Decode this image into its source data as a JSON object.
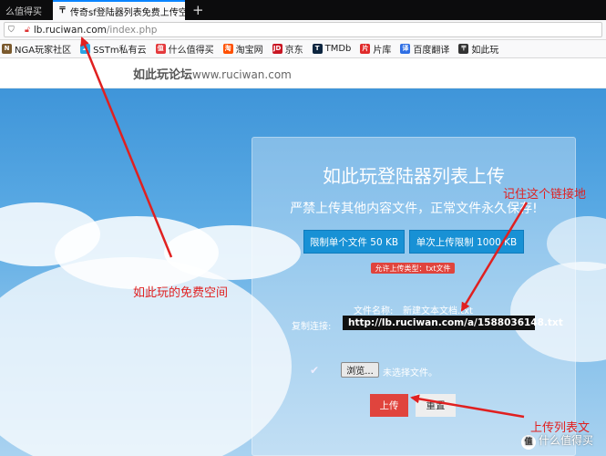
{
  "browser": {
    "tabs": [
      {
        "label": "么值得买",
        "active": false
      },
      {
        "label": "传奇sf登陆器列表免费上传空间",
        "active": true
      }
    ],
    "new_tab_symbol": "+",
    "close_symbol": "✕",
    "url_domain": "lb.ruciwan.com",
    "url_path": "/index.php"
  },
  "bookmarks": [
    {
      "label": "NGA玩家社区",
      "icon": "nga-icon",
      "color": "#7b5a2e"
    },
    {
      "label": "SSTm私有云",
      "icon": "cloud-icon",
      "color": "#2aa4e4"
    },
    {
      "label": "什么值得买",
      "icon": "smzdm-icon",
      "color": "#e4393c"
    },
    {
      "label": "淘宝网",
      "icon": "taobao-icon",
      "color": "#ff5000"
    },
    {
      "label": "京东",
      "icon": "jd-icon",
      "color": "#c91623"
    },
    {
      "label": "TMDb",
      "icon": "tmdb-icon",
      "color": "#0d253f"
    },
    {
      "label": "片库",
      "icon": "pianku-icon",
      "color": "#e02b2b"
    },
    {
      "label": "百度翻译",
      "icon": "baidu-translate-icon",
      "color": "#2f6fe4"
    },
    {
      "label": "如此玩",
      "icon": "ruciwan-icon",
      "color": "#333333"
    }
  ],
  "site": {
    "logo_cn": "如此玩论坛",
    "logo_en": "www.ruciwan.com"
  },
  "upload": {
    "title": "如此玩登陆器列表上传",
    "subtitle": "严禁上传其他内容文件，正常文件永久保存!",
    "limit_single": "限制单个文件 50 KB",
    "limit_once": "单次上传限制 1000 KB",
    "allowed_type": "允许上传类型：txt文件",
    "file_name_label": "文件名称:",
    "file_name_value": "新建文本文档.txt",
    "copy_link_label": "复制连接:",
    "copy_link_value": "http://lb.ruciwan.com/a/1588036148.txt",
    "browse_label": "浏览...",
    "no_file_label": "未选择文件。",
    "upload_button": "上传",
    "reset_button": "重置"
  },
  "annotations": {
    "free_space": "如此玩的免费空间",
    "remember_link": "记住这个链接地",
    "upload_list": "上传列表文"
  },
  "watermark": {
    "badge": "值",
    "text": "什么值得买"
  },
  "colors": {
    "accent_blue": "#1891d5",
    "accent_red": "#e0443d",
    "annotation_red": "#e02020"
  }
}
